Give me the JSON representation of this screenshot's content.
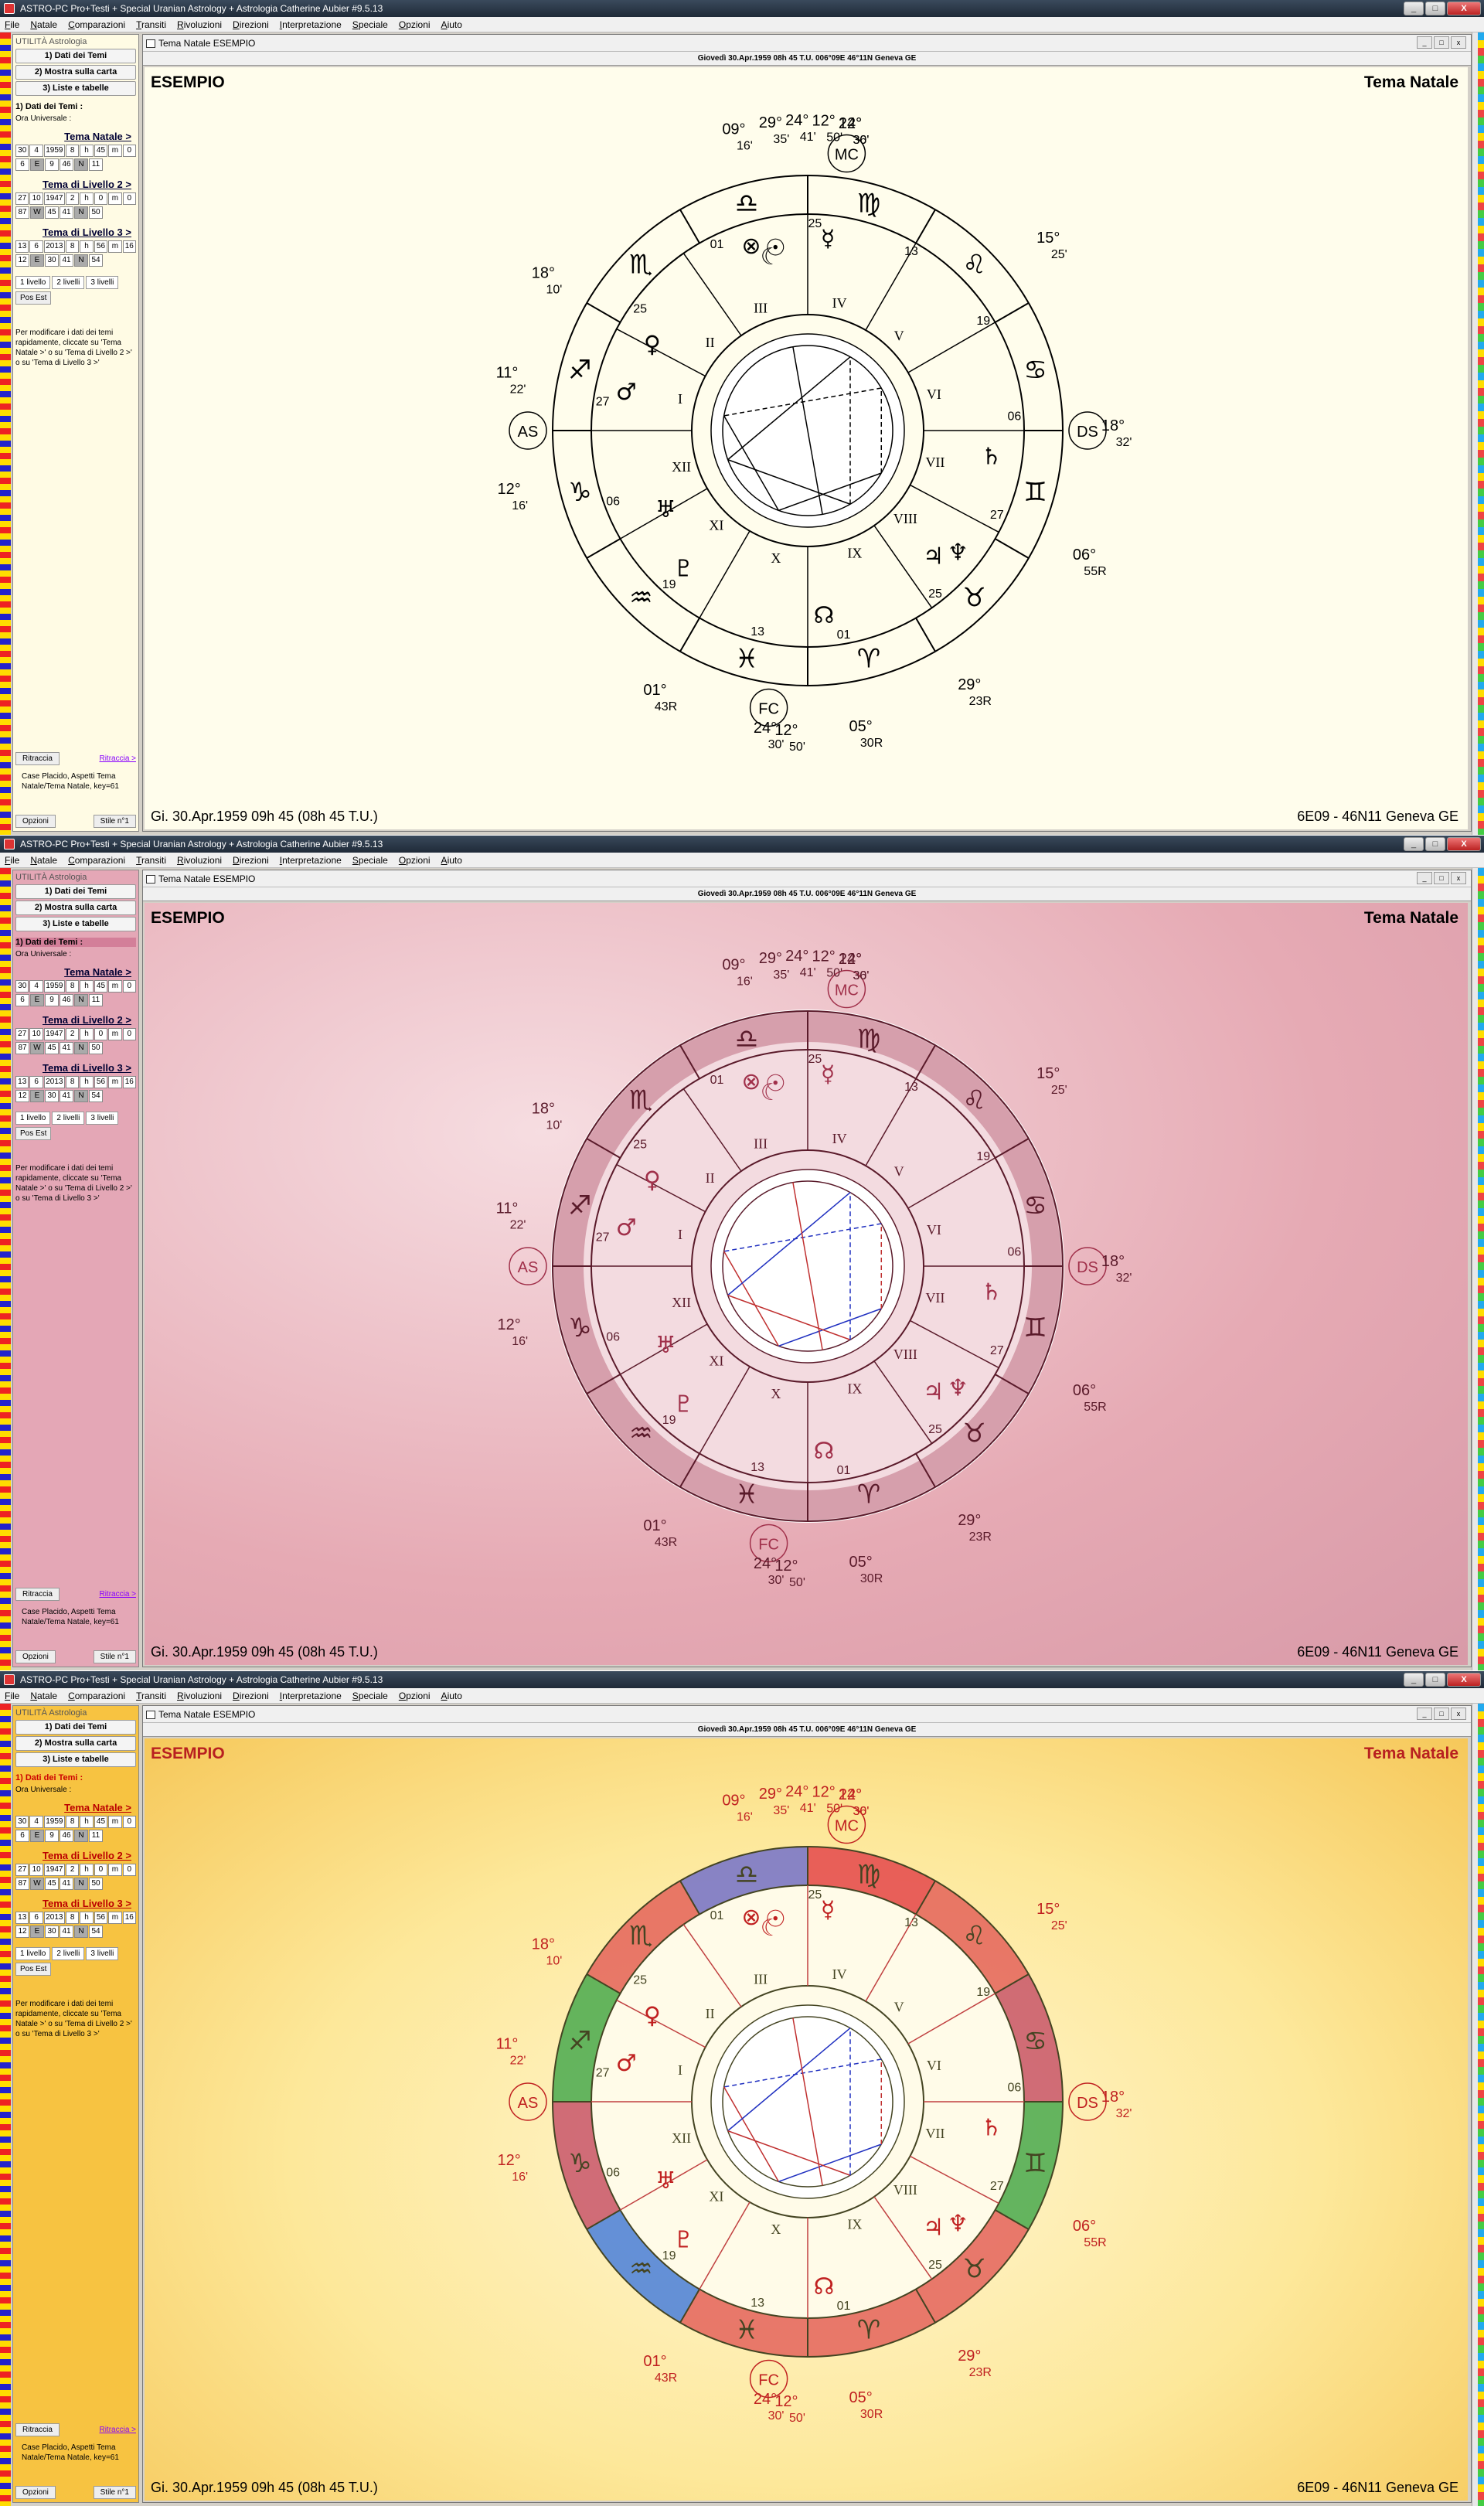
{
  "app": {
    "title": "ASTRO-PC Pro+Testi + Special Uranian Astrology + Astrologia Catherine Aubier #9.5.13"
  },
  "menu": [
    "File",
    "Natale",
    "Comparazioni",
    "Transiti",
    "Rivoluzioni",
    "Direzioni",
    "Interpretazione",
    "Speciale",
    "Opzioni",
    "Aiuto"
  ],
  "sidebar": {
    "header": "UTILITÀ Astrologia",
    "btn1": "1) Dati dei Temi",
    "btn2": "2) Mostra sulla carta",
    "btn3": "3) Liste e tabelle",
    "section": "1) Dati dei Temi :",
    "ut": "Ora Universale :",
    "lvl1": "Tema Natale >",
    "lvl1_r1": [
      "30",
      "4",
      "1959",
      "8",
      "h",
      "45",
      "m",
      "0"
    ],
    "lvl1_r2": [
      "6",
      "E",
      "9",
      "46",
      "N",
      "11"
    ],
    "lvl2": "Tema di Livello 2 >",
    "lvl2_r1": [
      "27",
      "10",
      "1947",
      "2",
      "h",
      "0",
      "m",
      "0"
    ],
    "lvl2_r2": [
      "87",
      "W",
      "45",
      "41",
      "N",
      "50"
    ],
    "lvl3": "Tema di Livello 3 >",
    "lvl3_r1": [
      "13",
      "6",
      "2013",
      "8",
      "h",
      "56",
      "m",
      "16"
    ],
    "lvl3_r2": [
      "12",
      "E",
      "30",
      "41",
      "N",
      "54"
    ],
    "b1": "1 livello",
    "b2": "2 livelli",
    "b3": "3 livelli",
    "pos": "Pos Est",
    "note": "Per modificare i dati dei temi rapidamente, cliccate su 'Tema Natale >' o su 'Tema di Livello 2 >' o su 'Tema di Livello 3 >'",
    "ritraccia": "Ritraccia",
    "ritraccia_link": "Ritraccia >",
    "case": "Case Placido, Aspetti Tema Natale/Tema Natale, key=61",
    "opzioni": "Opzioni",
    "stile": "Stile n°1"
  },
  "chart_win": {
    "title": "Tema Natale  ESEMPIO",
    "subtitle": "Giovedì 30.Apr.1959 08h 45 T.U. 006°09E 46°11N  Geneva GE",
    "name": "ESEMPIO",
    "type": "Tema Natale",
    "bl": "Gi. 30.Apr.1959 09h 45 (08h 45 T.U.)",
    "br": "6E09 - 46N11  Geneva GE",
    "br3": "6E09 - 46N11  Geneva GE"
  },
  "labels": {
    "ASC": "AS",
    "DSC": "DS",
    "MC": "MC",
    "FC": "FC"
  },
  "cusps": [
    {
      "d": "09°",
      "m": "16'"
    },
    {
      "d": "29°",
      "m": "35'"
    },
    {
      "d": "24°",
      "m": "41'"
    },
    {
      "d": "12°",
      "m": "50'"
    },
    {
      "d": "12°",
      "m": "36'"
    },
    {
      "d": "24°",
      "m": "30'"
    },
    {
      "d": "18°",
      "m": "10'"
    },
    {
      "d": "15°",
      "m": "25'"
    },
    {
      "d": "11°",
      "m": "22'"
    },
    {
      "d": "18°",
      "m": "32'"
    },
    {
      "d": "06°",
      "m": "55R"
    },
    {
      "d": "12°",
      "m": "16'"
    },
    {
      "d": "01°",
      "m": "43R"
    },
    {
      "d": "29°",
      "m": "23R"
    },
    {
      "d": "24°",
      "m": "30'"
    },
    {
      "d": "12°",
      "m": "50'"
    },
    {
      "d": "05°",
      "m": "30R"
    }
  ],
  "houses": [
    "I",
    "II",
    "III",
    "IV",
    "V",
    "VI",
    "VII",
    "VIII",
    "IX",
    "X",
    "XI",
    "XII"
  ],
  "signs": [
    "♈",
    "♉",
    "♊",
    "♋",
    "♌",
    "♍",
    "♎",
    "♏",
    "♐",
    "♑",
    "♒",
    "♓"
  ],
  "planets": [
    "☉",
    "☾",
    "☿",
    "♀",
    "♂",
    "♃",
    "♄",
    "♅",
    "♆",
    "♇",
    "☊",
    "⊗"
  ],
  "deg": [
    "01",
    "25",
    "27",
    "06",
    "19",
    "13",
    "25",
    "01",
    "25",
    "27",
    "06",
    "19",
    "13"
  ],
  "theme": {
    "c1": "#000000",
    "c2": "#a0304a",
    "c3": "#c02020"
  }
}
